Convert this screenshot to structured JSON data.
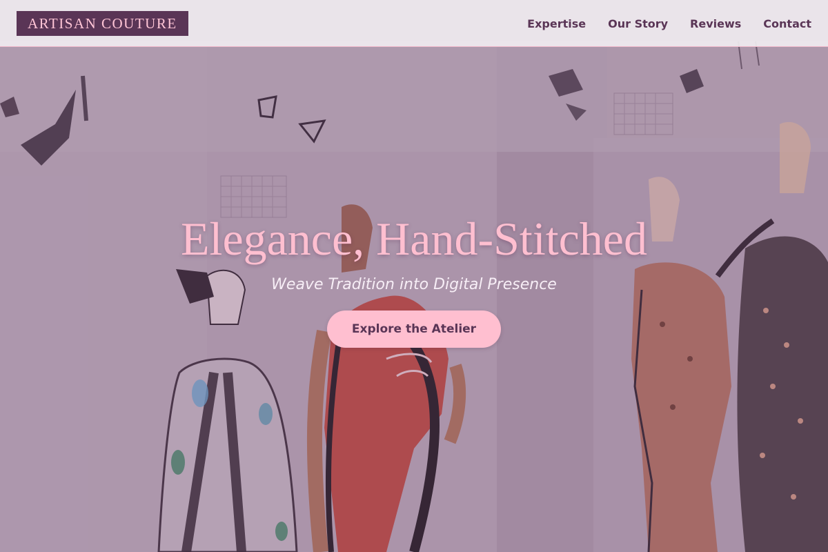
{
  "brand": {
    "logo_text": "ARTISAN COUTURE"
  },
  "nav": {
    "items": [
      {
        "label": "Expertise"
      },
      {
        "label": "Our Story"
      },
      {
        "label": "Reviews"
      },
      {
        "label": "Contact"
      }
    ]
  },
  "hero": {
    "title": "Elegance, Hand-Stitched",
    "subtitle": "Weave Tradition into Digital Presence",
    "cta_label": "Explore the Atelier",
    "background_image": "fashion-sketches-photo"
  },
  "colors": {
    "brand_plum": "#5a3556",
    "accent_pink": "#ffbfd0",
    "header_bg": "#f0ecf0",
    "hero_tint": "#9a7e96"
  }
}
